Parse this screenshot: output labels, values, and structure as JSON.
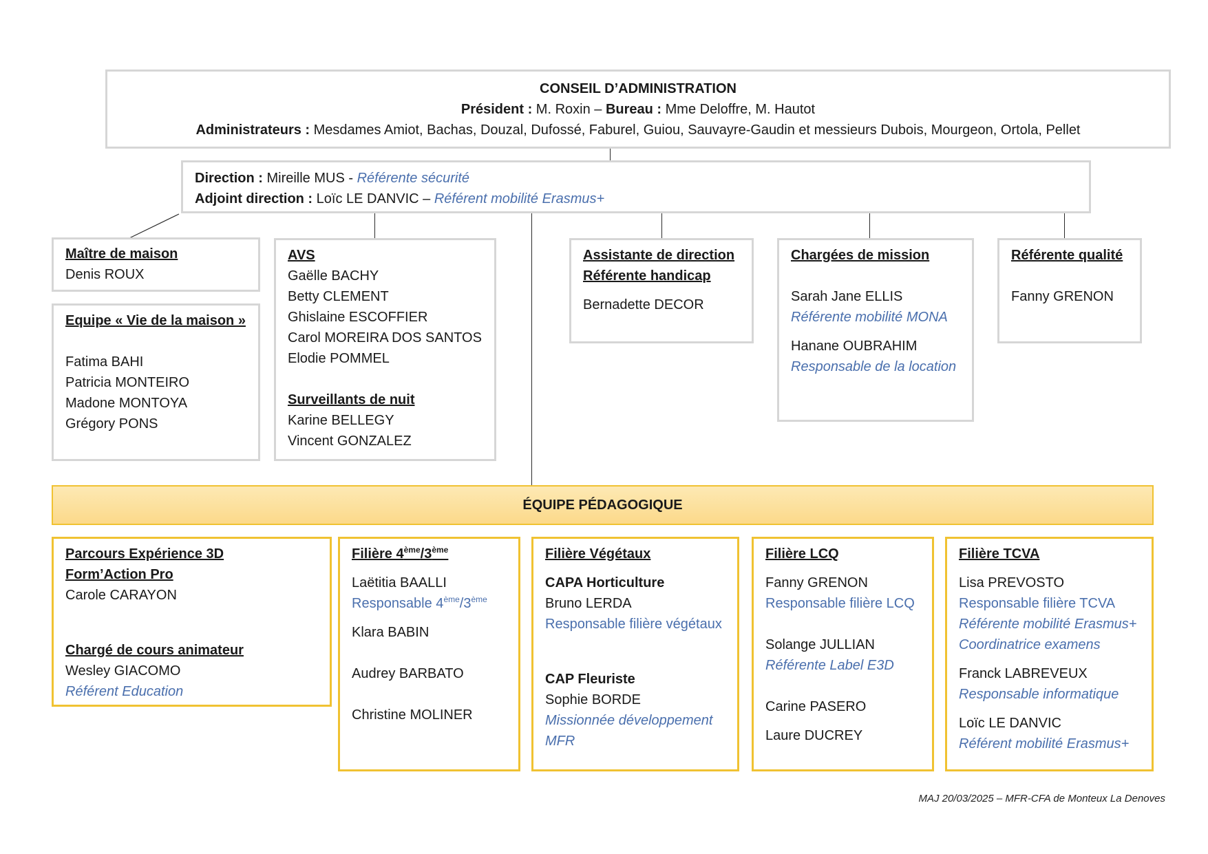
{
  "conseil": {
    "title": "CONSEIL D’ADMINISTRATION",
    "president_label": "Président :",
    "president_value": " M. Roxin – ",
    "bureau_label": "Bureau :",
    "bureau_value": " Mme Deloffre, M. Hautot",
    "admin_label": "Administrateurs :",
    "admin_value": " Mesdames Amiot, Bachas, Douzal, Dufossé, Faburel, Guiou, Sauvayre-Gaudin et messieurs Dubois, Mourgeon, Ortola, Pellet"
  },
  "direction": {
    "label": "Direction :",
    "name": " Mireille MUS - ",
    "role": "Référente sécurité",
    "adjoint_label": "Adjoint direction :",
    "adjoint_name": " Loïc LE DANVIC – ",
    "adjoint_role": "Référent mobilité Erasmus+"
  },
  "maitre": {
    "title": "Maître de maison",
    "name": "Denis ROUX"
  },
  "vie": {
    "title": "Equipe « Vie de la maison »",
    "members": [
      "Fatima BAHI",
      "Patricia MONTEIRO",
      "Madone MONTOYA",
      "Grégory PONS"
    ]
  },
  "avs": {
    "title": "AVS",
    "members": [
      "Gaëlle BACHY",
      "Betty CLEMENT",
      "Ghislaine ESCOFFIER",
      "Carol MOREIRA DOS SANTOS",
      "Elodie POMMEL"
    ],
    "nuit_title": "Surveillants de nuit",
    "nuit_members": [
      "Karine BELLEGY",
      "Vincent GONZALEZ"
    ]
  },
  "assistante": {
    "title1": "Assistante de direction",
    "title2": "Référente handicap",
    "name": "Bernadette DECOR"
  },
  "chargees": {
    "title": "Chargées de mission",
    "p1_name": "Sarah Jane ELLIS",
    "p1_role": "Référente mobilité MONA",
    "p2_name": "Hanane OUBRAHIM",
    "p2_role": "Responsable de la location"
  },
  "qualite": {
    "title": "Référente qualité",
    "name": "Fanny GRENON"
  },
  "equipe": {
    "title": "ÉQUIPE PÉDAGOGIQUE"
  },
  "parcours": {
    "title1": "Parcours Expérience 3D",
    "title2": "Form’Action Pro",
    "name": "Carole CARAYON",
    "charge_title": "Chargé de cours animateur",
    "charge_name": "Wesley GIACOMO",
    "charge_role": "Référent Education"
  },
  "filiere43": {
    "title_a": "Filière 4",
    "sup1": "ème",
    "title_b": "/3",
    "sup2": "ème",
    "p1_name": "Laëtitia BAALLI",
    "p1_role_a": "Responsable 4",
    "p1_role_b": "/3",
    "p2_name": "Klara BABIN",
    "p3_name": "Audrey BARBATO",
    "p4_name": "Christine MOLINER"
  },
  "vegetaux": {
    "title": "Filière Végétaux",
    "sub1": "CAPA Horticulture",
    "sub1_name": "Bruno LERDA",
    "sub1_role": "Responsable filière végétaux",
    "sub2": "CAP Fleuriste",
    "sub2_name": "Sophie BORDE",
    "sub2_role1": "Missionnée développement",
    "sub2_role2": "MFR"
  },
  "lcq": {
    "title": "Filière LCQ",
    "p1_name": "Fanny GRENON",
    "p1_role": "Responsable filière LCQ",
    "p2_name": "Solange JULLIAN",
    "p2_role": "Référente Label E3D",
    "p3_name": "Carine PASERO",
    "p4_name": "Laure DUCREY"
  },
  "tcva": {
    "title": "Filière TCVA",
    "p1_name": "Lisa PREVOSTO",
    "p1_role1": "Responsable filière TCVA",
    "p1_role2": "Référente mobilité Erasmus+",
    "p1_role3": "Coordinatrice examens",
    "p2_name": "Franck LABREVEUX",
    "p2_role": "Responsable informatique",
    "p3_name": "Loïc LE DANVIC",
    "p3_role": "Référent mobilité Erasmus+"
  },
  "footer": "MAJ 20/03/2025 – MFR-CFA de Monteux La Denoves",
  "colors": {
    "accent_blue": "#4a6fad",
    "gold_border": "#f0c232",
    "grey_border": "#d6d6d6"
  }
}
